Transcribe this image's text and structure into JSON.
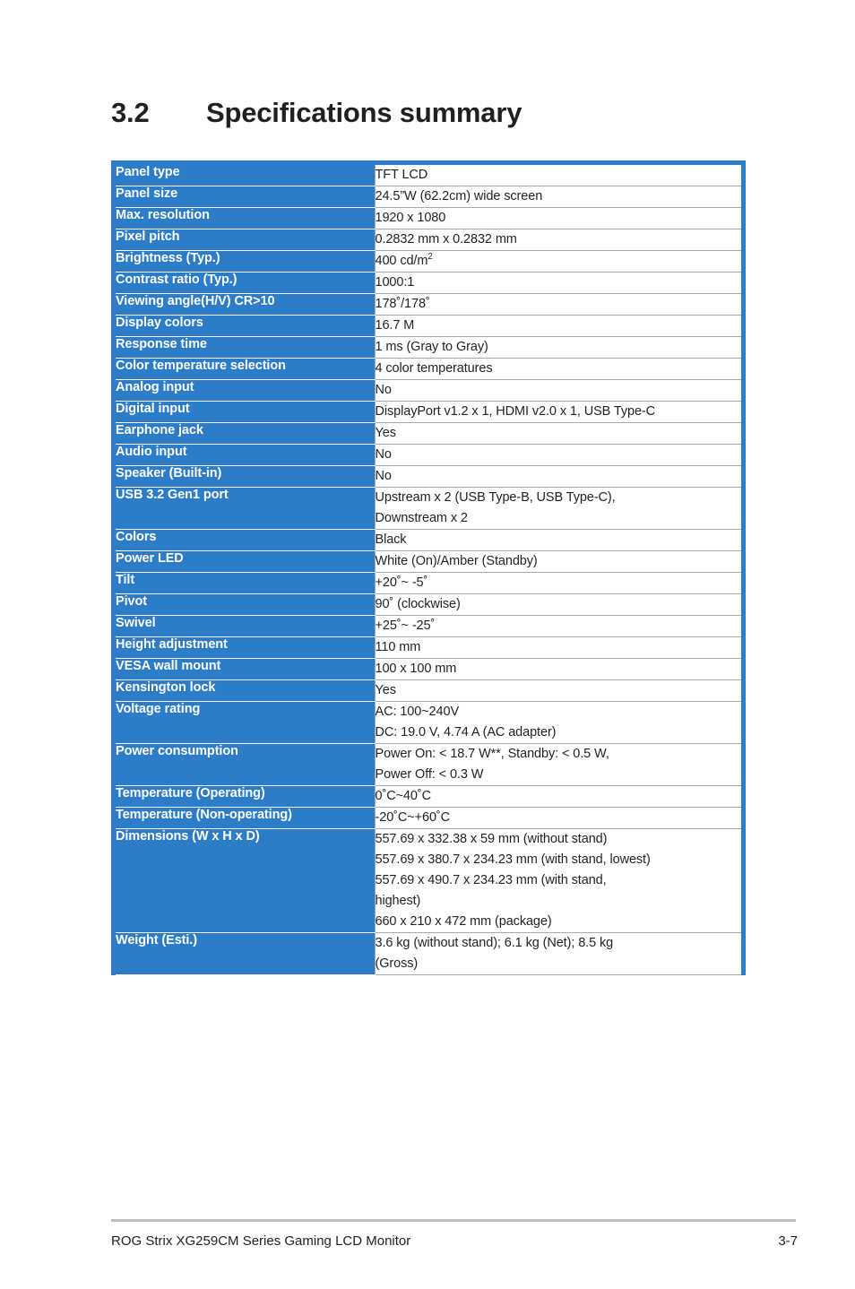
{
  "heading": {
    "number": "3.2",
    "title": "Specifications summary"
  },
  "colors": {
    "accent_blue": "#2d7cc8",
    "rule_gray": "#a7a9ac",
    "footer_rule_gray": "#bcbec0",
    "text": "#231f20"
  },
  "table": {
    "rows": [
      {
        "label": "Panel type",
        "lines": [
          "TFT LCD"
        ]
      },
      {
        "label": "Panel size",
        "lines": [
          "24.5”W (62.2cm) wide screen"
        ]
      },
      {
        "label": "Max. resolution",
        "lines": [
          "1920 x 1080"
        ]
      },
      {
        "label": "Pixel pitch",
        "lines": [
          "0.2832 mm x 0.2832 mm"
        ]
      },
      {
        "label": "Brightness (Typ.)",
        "lines": [
          "400 cd/m²"
        ],
        "html_sup": true
      },
      {
        "label": "Contrast ratio (Typ.)",
        "lines": [
          "1000:1"
        ]
      },
      {
        "label": "Viewing angle(H/V) CR>10",
        "lines": [
          "178˚/178˚"
        ]
      },
      {
        "label": "Display colors",
        "lines": [
          "16.7 M"
        ]
      },
      {
        "label": "Response time",
        "lines": [
          "1 ms (Gray to Gray)"
        ]
      },
      {
        "label": "Color temperature selection",
        "lines": [
          "4 color temperatures"
        ]
      },
      {
        "label": "Analog input",
        "lines": [
          "No"
        ]
      },
      {
        "label": "Digital input",
        "lines": [
          "DisplayPort v1.2 x 1, HDMI v2.0 x 1, USB Type-C"
        ]
      },
      {
        "label": "Earphone jack",
        "lines": [
          "Yes"
        ]
      },
      {
        "label": "Audio input",
        "lines": [
          "No"
        ]
      },
      {
        "label": "Speaker (Built-in)",
        "lines": [
          "No"
        ]
      },
      {
        "label": "USB 3.2 Gen1 port",
        "lines": [
          "Upstream x 2 (USB Type-B, USB Type-C),",
          "Downstream x 2"
        ]
      },
      {
        "label": "Colors",
        "lines": [
          "Black"
        ]
      },
      {
        "label": "Power LED",
        "lines": [
          "White (On)/Amber (Standby)"
        ]
      },
      {
        "label": "Tilt",
        "lines": [
          "+20˚~ -5˚"
        ]
      },
      {
        "label": "Pivot",
        "lines": [
          "90˚ (clockwise)"
        ]
      },
      {
        "label": "Swivel",
        "lines": [
          "+25˚~ -25˚"
        ]
      },
      {
        "label": "Height adjustment",
        "lines": [
          "110 mm"
        ]
      },
      {
        "label": "VESA wall mount",
        "lines": [
          "100 x 100 mm"
        ]
      },
      {
        "label": "Kensington lock",
        "lines": [
          "Yes"
        ]
      },
      {
        "label": "Voltage rating",
        "lines": [
          "AC: 100~240V",
          "DC: 19.0 V, 4.74 A (AC adapter)"
        ]
      },
      {
        "label": "Power consumption",
        "lines": [
          "Power On: < 18.7 W**, Standby: < 0.5 W,",
          "Power Off: < 0.3 W"
        ]
      },
      {
        "label": "Temperature (Operating)",
        "lines": [
          "0˚C~40˚C"
        ]
      },
      {
        "label": "Temperature (Non-operating)",
        "lines": [
          "-20˚C~+60˚C"
        ]
      },
      {
        "label": "Dimensions (W x H x D)",
        "lines": [
          "557.69 x 332.38 x 59 mm (without stand)",
          "557.69 x 380.7 x 234.23 mm (with stand, lowest)",
          "557.69 x 490.7 x 234.23 mm  (with stand,",
          "highest)",
          "660 x 210 x 472 mm (package)"
        ]
      },
      {
        "label": "Weight (Esti.)",
        "lines": [
          "3.6 kg (without stand); 6.1 kg (Net); 8.5 kg",
          "(Gross)"
        ]
      }
    ]
  },
  "footer": {
    "doc_title": "ROG Strix XG259CM Series Gaming LCD Monitor",
    "page_number": "3-7"
  }
}
